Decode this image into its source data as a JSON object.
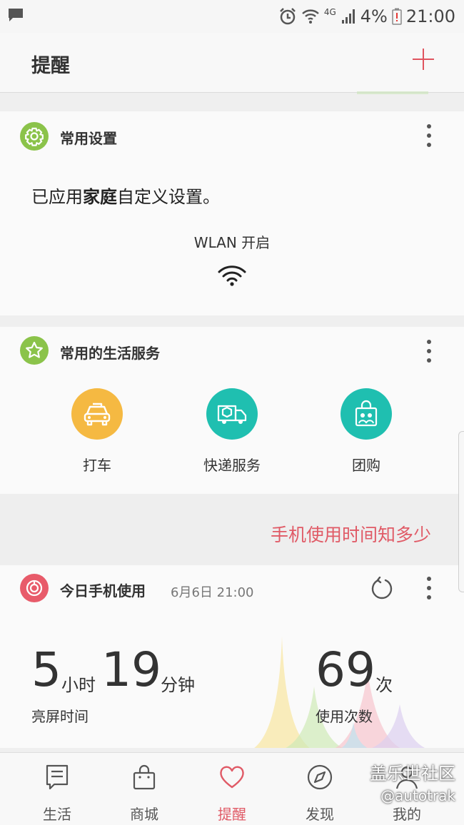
{
  "status_bar": {
    "battery": "4%",
    "time": "21:00",
    "network": "4G",
    "icons": [
      "message-icon",
      "alarm-icon",
      "wifi-icon",
      "signal-icon",
      "battery-low-icon"
    ]
  },
  "app_bar": {
    "title": "提醒",
    "add_icon": "plus-icon"
  },
  "settings_card": {
    "title": "常用设置",
    "applied_prefix": "已应用",
    "applied_profile": "家庭",
    "applied_suffix": "自定义设置。",
    "wlan_status": "WLAN 开启",
    "icon": "gear-icon"
  },
  "services_card": {
    "title": "常用的生活服务",
    "icon": "star-icon",
    "items": [
      {
        "label": "打车",
        "icon": "taxi-icon",
        "color": "#f5b942"
      },
      {
        "label": "快递服务",
        "icon": "delivery-truck-icon",
        "color": "#1fbfb0"
      },
      {
        "label": "团购",
        "icon": "shopping-bag-icon",
        "color": "#1fbfb0"
      }
    ]
  },
  "banner": {
    "text": "手机使用时间知多少"
  },
  "usage_card": {
    "title": "今日手机使用",
    "timestamp": "6月6日 21:00",
    "hours": "5",
    "hours_unit": "小时",
    "minutes": "19",
    "minutes_unit": "分钟",
    "screen_time_label": "亮屏时间",
    "count": "69",
    "count_unit": "次",
    "count_label": "使用次数"
  },
  "tab_bar": {
    "tabs": [
      {
        "label": "生活",
        "icon": "life-icon"
      },
      {
        "label": "商城",
        "icon": "mall-bag-icon"
      },
      {
        "label": "提醒",
        "icon": "heart-icon",
        "active": true
      },
      {
        "label": "发现",
        "icon": "compass-icon"
      },
      {
        "label": "我的",
        "icon": "profile-icon"
      }
    ]
  },
  "watermark": {
    "line1": "盖乐世社区",
    "line2": "@autotrak"
  },
  "colors": {
    "accent": "#e05a66",
    "green": "#8bc34a",
    "teal": "#1fbfb0",
    "yellow": "#f5b942"
  }
}
